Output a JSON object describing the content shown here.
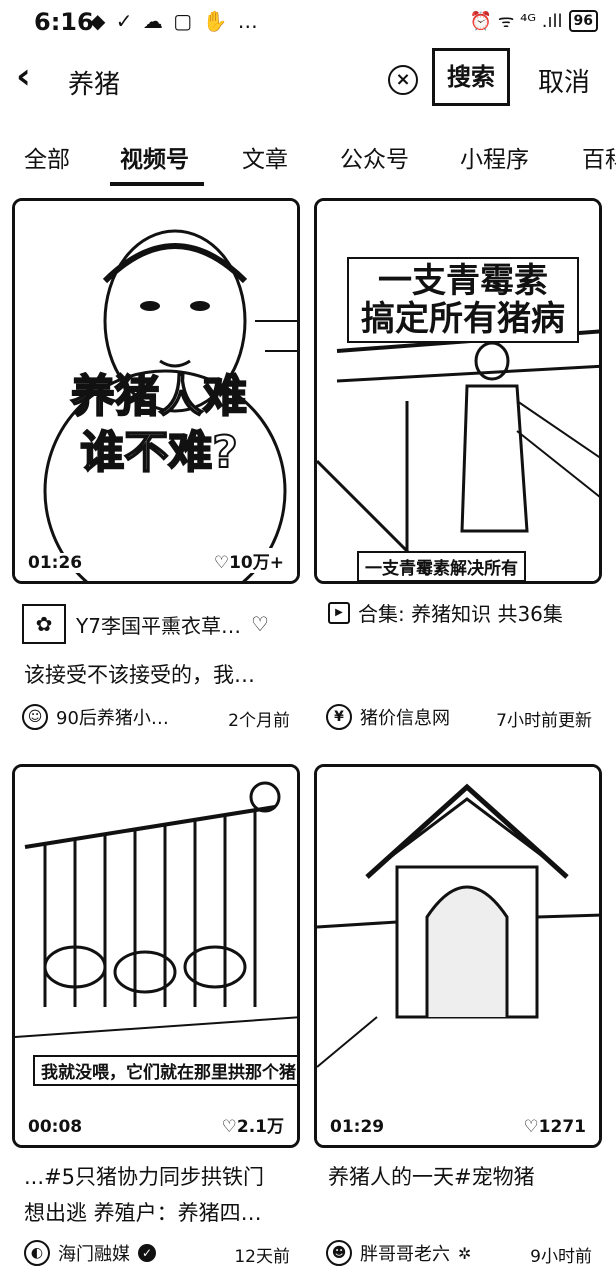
{
  "status_bar": {
    "time": "6:16",
    "left_icons": "◆ ✓ ☁ ▢ ✋ …",
    "right_icons": "⏰ ᯤ ⁴ᴳ .ıll",
    "battery": "96"
  },
  "header": {
    "back_icon": "‹",
    "query": "养猪",
    "clear_icon": "⊗",
    "search_label": "搜索",
    "cancel_label": "取消"
  },
  "tabs": [
    "全部",
    "视频号",
    "文章",
    "公众号",
    "小程序",
    "百科"
  ],
  "active_tab": "视频号",
  "cards": [
    {
      "overlay_text_1": "养猪人难",
      "overlay_text_2": "谁不难?",
      "duration": "01:26",
      "likes": "♡10万+",
      "channel_name": "Y7李国平熏衣草…",
      "description": "该接受不该接受的，我…",
      "author": "90后养猪小…",
      "time": "2个月前"
    },
    {
      "overlay_text_1": "一支青霉素",
      "overlay_text_2": "搞定所有猪病",
      "subtitle": "一支青霉素解决所有",
      "collection": "合集: 养猪知识 共36集",
      "author": "猪价信息网",
      "time": "7小时前更新"
    },
    {
      "subtitle": "我就没喂，它们就在那里拱那个猪门",
      "duration": "00:08",
      "likes": "♡2.1万",
      "description_1": "...#5只猪协力同步拱铁门",
      "description_2": "想出逃 养殖户：养猪四…",
      "author": "海门融媒",
      "time": "12天前"
    },
    {
      "duration": "01:29",
      "likes": "♡1271",
      "description": "养猪人的一天#宠物猪",
      "author": "胖哥哥老六",
      "time": "9小时前"
    }
  ]
}
